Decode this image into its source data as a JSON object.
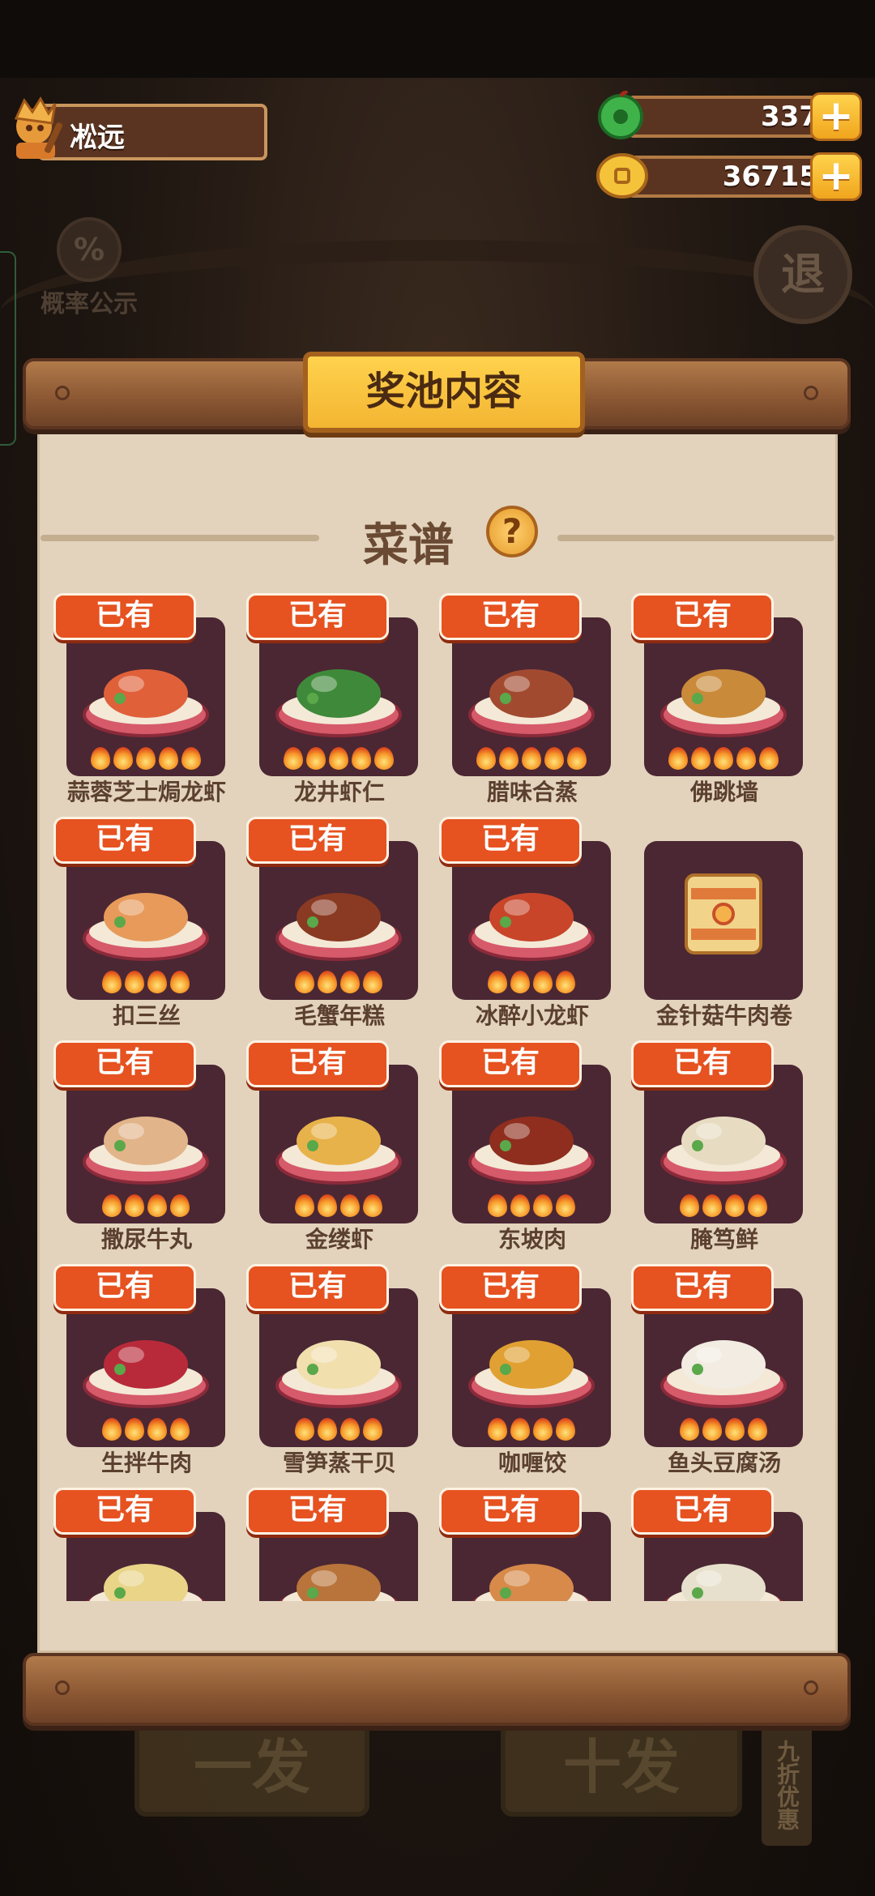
{
  "player": {
    "name": "凇远"
  },
  "currencies": [
    {
      "name": "jade",
      "value": "337",
      "icon": "jade-icon"
    },
    {
      "name": "coin",
      "value": "36715",
      "icon": "copper-coin-icon"
    }
  ],
  "background": {
    "probability_label": "概率公示",
    "probability_symbol": "%",
    "exit_label": "退",
    "single_draw": "一发",
    "ten_draw": "十发",
    "discount": "九折优惠"
  },
  "panel": {
    "title": "奖池内容",
    "section_title": "菜谱",
    "help_symbol": "?",
    "owned_label": "已有"
  },
  "recipes": [
    {
      "name": "蒜蓉芝士焗龙虾",
      "owned": true,
      "stars": 5,
      "color": "#e0603a"
    },
    {
      "name": "龙井虾仁",
      "owned": true,
      "stars": 5,
      "color": "#3f8a3a"
    },
    {
      "name": "腊味合蒸",
      "owned": true,
      "stars": 5,
      "color": "#a24a30"
    },
    {
      "name": "佛跳墙",
      "owned": true,
      "stars": 5,
      "color": "#c98a3a"
    },
    {
      "name": "扣三丝",
      "owned": true,
      "stars": 4,
      "color": "#e79a5a"
    },
    {
      "name": "毛蟹年糕",
      "owned": true,
      "stars": 4,
      "color": "#8a3a22"
    },
    {
      "name": "冰醉小龙虾",
      "owned": true,
      "stars": 4,
      "color": "#c8452a"
    },
    {
      "name": "金针菇牛肉卷",
      "owned": false,
      "stars": 0,
      "color": "#e0a86a"
    },
    {
      "name": "撒尿牛丸",
      "owned": true,
      "stars": 4,
      "color": "#e2b48a"
    },
    {
      "name": "金缕虾",
      "owned": true,
      "stars": 4,
      "color": "#e8b24a"
    },
    {
      "name": "东坡肉",
      "owned": true,
      "stars": 4,
      "color": "#8f2e1e"
    },
    {
      "name": "腌笃鲜",
      "owned": true,
      "stars": 4,
      "color": "#e7dcc2"
    },
    {
      "name": "生拌牛肉",
      "owned": true,
      "stars": 4,
      "color": "#b82a3a"
    },
    {
      "name": "雪笋蒸干贝",
      "owned": true,
      "stars": 4,
      "color": "#f1dfae"
    },
    {
      "name": "咖喱饺",
      "owned": true,
      "stars": 4,
      "color": "#e0a032"
    },
    {
      "name": "鱼头豆腐汤",
      "owned": true,
      "stars": 4,
      "color": "#f2ece2"
    },
    {
      "name": "",
      "owned": true,
      "stars": 0,
      "color": "#e9d488"
    },
    {
      "name": "",
      "owned": true,
      "stars": 0,
      "color": "#b8743a"
    },
    {
      "name": "",
      "owned": true,
      "stars": 0,
      "color": "#d88a4a"
    },
    {
      "name": "",
      "owned": true,
      "stars": 0,
      "color": "#e6e0cc"
    }
  ]
}
